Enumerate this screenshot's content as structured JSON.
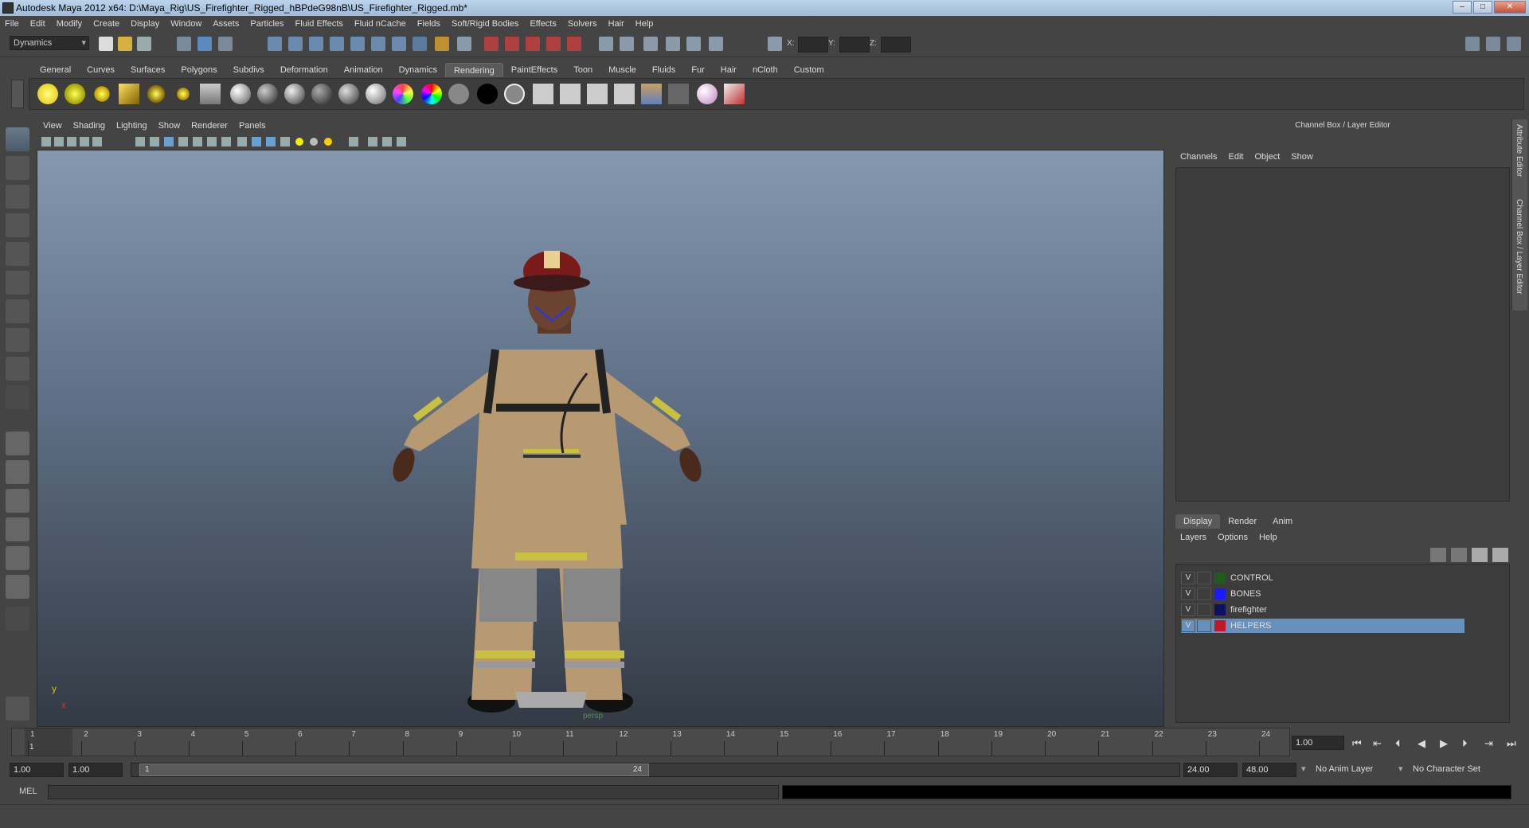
{
  "window": {
    "title": "Autodesk Maya 2012 x64: D:\\Maya_Rig\\US_Firefighter_Rigged_hBPdeG98nB\\US_Firefighter_Rigged.mb*"
  },
  "menubar": [
    "File",
    "Edit",
    "Modify",
    "Create",
    "Display",
    "Window",
    "Assets",
    "Particles",
    "Fluid Effects",
    "Fluid nCache",
    "Fields",
    "Soft/Rigid Bodies",
    "Effects",
    "Solvers",
    "Hair",
    "Help"
  ],
  "status_line": {
    "mode": "Dynamics",
    "x_label": "X:",
    "y_label": "Y:",
    "z_label": "Z:"
  },
  "shelf": {
    "tabs": [
      "General",
      "Curves",
      "Surfaces",
      "Polygons",
      "Subdivs",
      "Deformation",
      "Animation",
      "Dynamics",
      "Rendering",
      "PaintEffects",
      "Toon",
      "Muscle",
      "Fluids",
      "Fur",
      "Hair",
      "nCloth",
      "Custom"
    ],
    "active_tab": "Rendering"
  },
  "viewport": {
    "menu": [
      "View",
      "Shading",
      "Lighting",
      "Show",
      "Renderer",
      "Panels"
    ],
    "camera_label": "persp",
    "axis_y": "y",
    "axis_x": "x"
  },
  "channel_box": {
    "header": "Channel Box / Layer Editor",
    "menu": [
      "Channels",
      "Edit",
      "Object",
      "Show"
    ]
  },
  "side_tabs": [
    "Attribute Editor",
    "Channel Box / Layer Editor"
  ],
  "layer_editor": {
    "tabs": [
      "Display",
      "Render",
      "Anim"
    ],
    "active_tab": "Display",
    "menu": [
      "Layers",
      "Options",
      "Help"
    ],
    "layers": [
      {
        "visible": "V",
        "name": "CONTROL",
        "color": "#1f5a1f",
        "selected": false
      },
      {
        "visible": "V",
        "name": "BONES",
        "color": "#1a1aff",
        "selected": false
      },
      {
        "visible": "V",
        "name": "firefighter",
        "color": "#101060",
        "selected": false
      },
      {
        "visible": "V",
        "name": "HELPERS",
        "color": "#c0182a",
        "selected": true
      }
    ]
  },
  "timeline": {
    "ticks": [
      "1",
      "2",
      "3",
      "4",
      "5",
      "6",
      "7",
      "8",
      "9",
      "10",
      "11",
      "12",
      "13",
      "14",
      "15",
      "16",
      "17",
      "18",
      "19",
      "20",
      "21",
      "22",
      "23",
      "24"
    ],
    "current_marker": "1",
    "current_frame": "1.00"
  },
  "range": {
    "start": "1.00",
    "playback_start": "1.00",
    "handle_start": "1",
    "handle_end": "24",
    "playback_end": "24.00",
    "end": "48.00",
    "anim_layer": "No Anim Layer",
    "character_set": "No Character Set"
  },
  "command_line": {
    "label": "MEL"
  }
}
